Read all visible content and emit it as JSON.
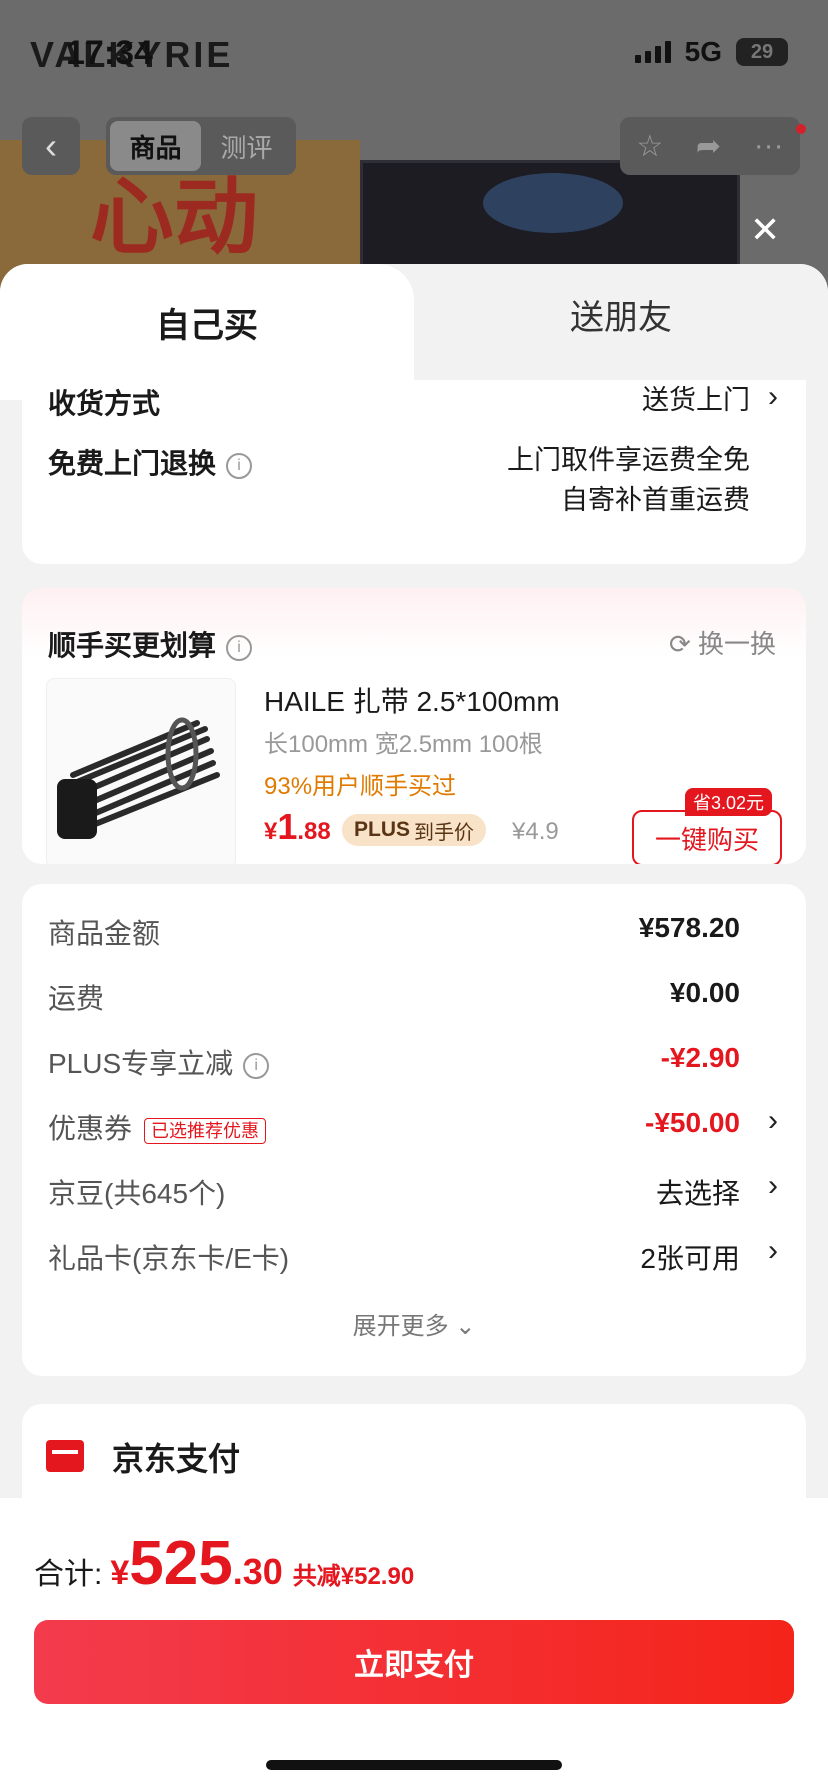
{
  "status_bar": {
    "time": "17:34",
    "network": "5G",
    "battery": "29"
  },
  "background": {
    "logo": "VALKYRIE",
    "banner_text": "心动",
    "tabs": [
      "商品",
      "测评"
    ],
    "active_tab": "商品"
  },
  "sheet": {
    "tabs": {
      "self": "自己买",
      "gift": "送朋友"
    },
    "delivery": {
      "method_label": "收货方式",
      "method_value": "送货上门",
      "return_label": "免费上门退换",
      "return_line1": "上门取件享运费全免",
      "return_line2": "自寄补首重运费"
    },
    "addon": {
      "title": "顺手买更划算",
      "swap": "换一换",
      "product_name": "HAILE 扎带 2.5*100mm",
      "spec": "长100mm 宽2.5mm 100根",
      "bought": "93%用户顺手买过",
      "price_symbol": "¥",
      "price_int": "1",
      "price_dec": ".88",
      "plus_tag": "PLUS",
      "plus_text": "到手价",
      "orig_price": "¥4.9",
      "save_badge": "省3.02元",
      "buy_button": "一键购买"
    },
    "fees": {
      "goods_label": "商品金额",
      "goods_value": "¥578.20",
      "shipping_label": "运费",
      "shipping_value": "¥0.00",
      "plus_label": "PLUS专享立减",
      "plus_value": "-¥2.90",
      "coupon_label": "优惠券",
      "coupon_tag": "已选推荐优惠",
      "coupon_value": "-¥50.00",
      "beans_label": "京豆(共645个)",
      "beans_value": "去选择",
      "giftcard_label": "礼品卡(京东卡/E卡)",
      "giftcard_value": "2张可用",
      "expand": "展开更多"
    },
    "payment": {
      "method": "京东支付"
    }
  },
  "footer": {
    "total_label": "合计:",
    "total_yen": "¥",
    "total_int": "525",
    "total_dec": ".30",
    "total_saved": "共减¥52.90",
    "pay_button": "立即支付"
  }
}
